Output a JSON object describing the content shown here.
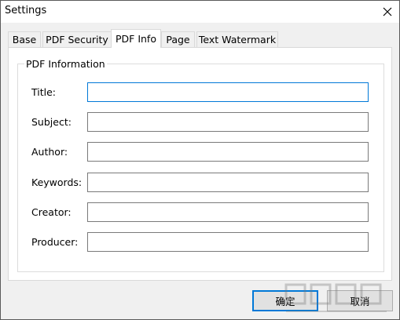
{
  "window": {
    "title": "Settings"
  },
  "tabs": [
    {
      "label": "Base"
    },
    {
      "label": "PDF Security"
    },
    {
      "label": "PDF Info",
      "active": true
    },
    {
      "label": "Page"
    },
    {
      "label": "Text Watermark"
    }
  ],
  "group": {
    "legend": "PDF Information"
  },
  "fields": [
    {
      "label": "Title:",
      "value": "",
      "focused": true
    },
    {
      "label": "Subject:",
      "value": ""
    },
    {
      "label": "Author:",
      "value": ""
    },
    {
      "label": "Keywords:",
      "value": ""
    },
    {
      "label": "Creator:",
      "value": ""
    },
    {
      "label": "Producer:",
      "value": ""
    }
  ],
  "buttons": {
    "ok_label": "确定",
    "cancel_label": "取消"
  },
  "colors": {
    "focus_border": "#0078d7",
    "tab_active_bg": "#ffffff",
    "dialog_bg": "#f0f0f0"
  }
}
